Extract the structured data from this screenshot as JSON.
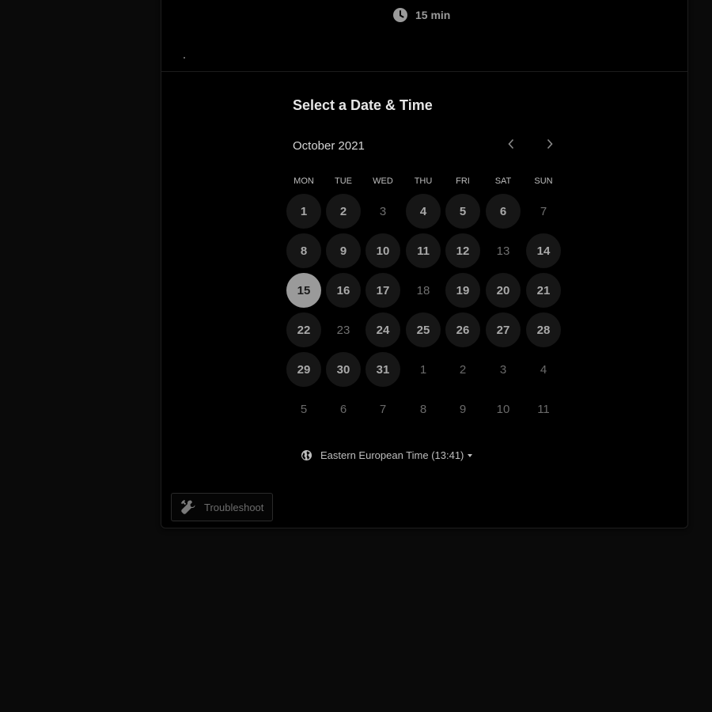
{
  "event": {
    "duration": "15 min"
  },
  "scheduler": {
    "title": "Select a Date & Time",
    "month_label": "October 2021",
    "weekdays": [
      "MON",
      "TUE",
      "WED",
      "THU",
      "FRI",
      "SAT",
      "SUN"
    ],
    "weeks": [
      [
        {
          "d": "1",
          "s": "available"
        },
        {
          "d": "2",
          "s": "available"
        },
        {
          "d": "3",
          "s": "unavailable"
        },
        {
          "d": "4",
          "s": "available"
        },
        {
          "d": "5",
          "s": "available"
        },
        {
          "d": "6",
          "s": "available"
        },
        {
          "d": "7",
          "s": "unavailable"
        }
      ],
      [
        {
          "d": "8",
          "s": "available"
        },
        {
          "d": "9",
          "s": "available"
        },
        {
          "d": "10",
          "s": "available"
        },
        {
          "d": "11",
          "s": "available"
        },
        {
          "d": "12",
          "s": "available"
        },
        {
          "d": "13",
          "s": "unavailable"
        },
        {
          "d": "14",
          "s": "available"
        }
      ],
      [
        {
          "d": "15",
          "s": "selected"
        },
        {
          "d": "16",
          "s": "available"
        },
        {
          "d": "17",
          "s": "available"
        },
        {
          "d": "18",
          "s": "unavailable"
        },
        {
          "d": "19",
          "s": "available"
        },
        {
          "d": "20",
          "s": "available"
        },
        {
          "d": "21",
          "s": "available"
        }
      ],
      [
        {
          "d": "22",
          "s": "available"
        },
        {
          "d": "23",
          "s": "unavailable"
        },
        {
          "d": "24",
          "s": "available"
        },
        {
          "d": "25",
          "s": "available"
        },
        {
          "d": "26",
          "s": "available"
        },
        {
          "d": "27",
          "s": "available"
        },
        {
          "d": "28",
          "s": "available"
        }
      ],
      [
        {
          "d": "29",
          "s": "available"
        },
        {
          "d": "30",
          "s": "available"
        },
        {
          "d": "31",
          "s": "available"
        },
        {
          "d": "1",
          "s": "outside"
        },
        {
          "d": "2",
          "s": "outside"
        },
        {
          "d": "3",
          "s": "outside"
        },
        {
          "d": "4",
          "s": "outside"
        }
      ],
      [
        {
          "d": "5",
          "s": "outside"
        },
        {
          "d": "6",
          "s": "outside"
        },
        {
          "d": "7",
          "s": "outside"
        },
        {
          "d": "8",
          "s": "outside"
        },
        {
          "d": "9",
          "s": "outside"
        },
        {
          "d": "10",
          "s": "outside"
        },
        {
          "d": "11",
          "s": "outside"
        }
      ]
    ],
    "timezone": "Eastern European Time (13:41)"
  },
  "footer": {
    "troubleshoot_label": "Troubleshoot"
  },
  "icons": {
    "clock": "clock-icon",
    "prev": "chevron-left-icon",
    "next": "chevron-right-icon",
    "globe": "globe-icon",
    "caret": "caret-down-icon",
    "wrench": "wrench-icon"
  },
  "colors": {
    "background": "#0a0a0a",
    "card": "#000000",
    "available_day_bg": "#161616",
    "selected_day_bg": "#9a9a9a"
  }
}
